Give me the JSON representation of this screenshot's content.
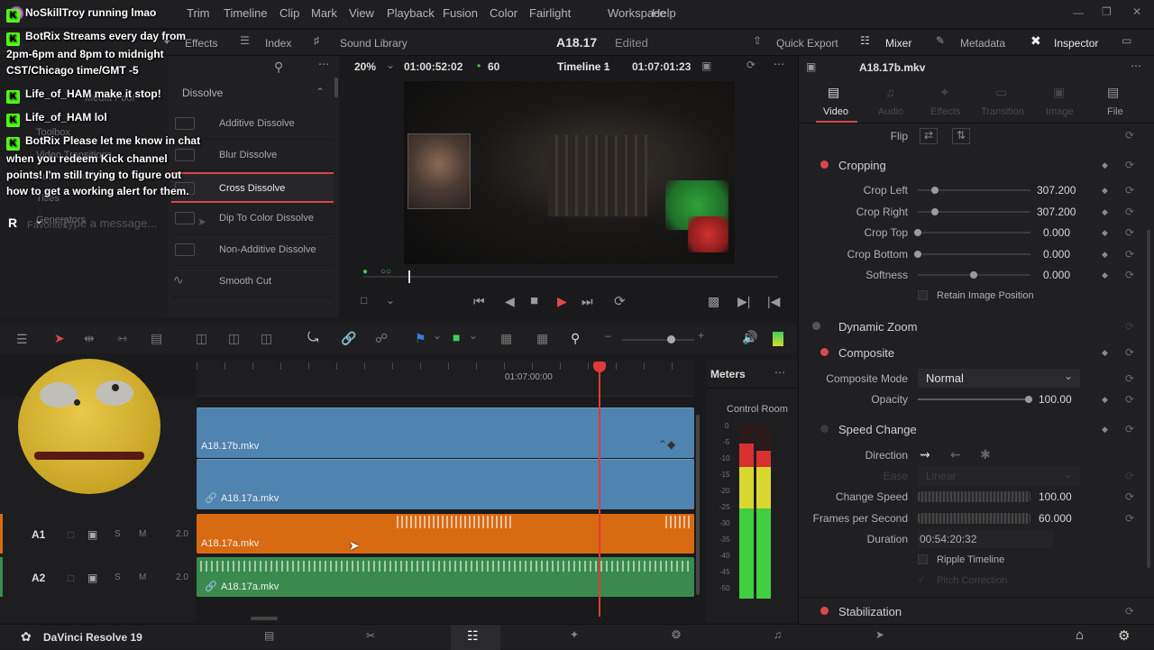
{
  "menubar": {
    "items": [
      "Trim",
      "Timeline",
      "Clip",
      "Mark",
      "View",
      "Playback",
      "Fusion",
      "Color",
      "Fairlight",
      "Workspace",
      "Help"
    ]
  },
  "toolbar": {
    "effects": "Effects",
    "index": "Index",
    "sound_library": "Sound Library",
    "project_name": "A18.17",
    "project_status": "Edited",
    "quick_export": "Quick Export",
    "mixer": "Mixer",
    "metadata": "Metadata",
    "inspector": "Inspector"
  },
  "chat": {
    "lines": [
      {
        "user": "NoSkillTroy",
        "text": "running lmao"
      },
      {
        "user": "BotRix",
        "text": "Streams every day from 2pm-6pm and 8pm to midnight CST/Chicago time/GMT -5"
      },
      {
        "user": "Life_of_HAM",
        "text": "make it stop!"
      },
      {
        "user": "Life_of_HAM",
        "text": "lol"
      },
      {
        "user": "BotRix",
        "text": "Please let me know in chat when you redeem Kick channel points! I'm still trying to figure out how to get a working alert for them."
      }
    ],
    "input_placeholder": "Type a message..."
  },
  "effects_panel": {
    "bg_labels": [
      "Media Pool",
      "Toolbox",
      "Video Transitions",
      "Audio Transitions",
      "Titles",
      "Generators",
      "Favorites"
    ],
    "header": "Dissolve",
    "items": [
      {
        "label": "Additive Dissolve",
        "selected": false
      },
      {
        "label": "Blur Dissolve",
        "selected": false
      },
      {
        "label": "Cross Dissolve",
        "selected": true
      },
      {
        "label": "Dip To Color Dissolve",
        "selected": false
      },
      {
        "label": "Non-Additive Dissolve",
        "selected": false
      },
      {
        "label": "Smooth Cut",
        "selected": false
      }
    ]
  },
  "viewer": {
    "zoom": "20%",
    "source_timecode": "01:00:52:02",
    "fps": "60",
    "timeline_name": "Timeline 1",
    "record_timecode": "01:07:01:23"
  },
  "inspector": {
    "clip_name": "A18.17b.mkv",
    "tabs": [
      {
        "label": "Video",
        "active": true
      },
      {
        "label": "Audio",
        "active": false
      },
      {
        "label": "Effects",
        "active": false
      },
      {
        "label": "Transition",
        "active": false
      },
      {
        "label": "Image",
        "active": false
      },
      {
        "label": "File",
        "active": false
      }
    ],
    "flip_label": "Flip",
    "cropping": {
      "title": "Cropping",
      "crop_left": {
        "label": "Crop Left",
        "value": "307.200"
      },
      "crop_right": {
        "label": "Crop Right",
        "value": "307.200"
      },
      "crop_top": {
        "label": "Crop Top",
        "value": "0.000"
      },
      "crop_bottom": {
        "label": "Crop Bottom",
        "value": "0.000"
      },
      "softness": {
        "label": "Softness",
        "value": "0.000"
      },
      "retain": "Retain Image Position"
    },
    "dynamic_zoom": "Dynamic Zoom",
    "composite": {
      "title": "Composite",
      "mode_label": "Composite Mode",
      "mode_value": "Normal",
      "opacity_label": "Opacity",
      "opacity_value": "100.00"
    },
    "speed_change": {
      "title": "Speed Change",
      "direction_label": "Direction",
      "ease_label": "Ease",
      "ease_value": "Linear",
      "change_speed_label": "Change Speed",
      "change_speed_value": "100.00",
      "fps_label": "Frames per Second",
      "fps_value": "60.000",
      "duration_label": "Duration",
      "duration_value": "00:54:20:32",
      "ripple_label": "Ripple Timeline",
      "pitch_label": "Pitch Correction"
    },
    "stabilization": "Stabilization"
  },
  "timeline": {
    "ruler_timecode": "01:07:00:00",
    "video_clips": [
      "A18.17b.mkv",
      "A18.17a.mkv"
    ],
    "audio_tracks": [
      {
        "name": "A1",
        "level": "2.0",
        "clip": "A18.17a.mkv"
      },
      {
        "name": "A2",
        "level": "2.0",
        "clip": "A18.17a.mkv"
      }
    ],
    "track_flag_s": "S",
    "track_flag_m": "M"
  },
  "meters": {
    "title": "Meters",
    "subtitle": "Control Room",
    "scale": [
      "0",
      "-5",
      "-10",
      "-15",
      "-20",
      "-25",
      "-30",
      "-35",
      "-40",
      "-45",
      "-50"
    ]
  },
  "bottombar": {
    "app_name": "DaVinci Resolve 19"
  },
  "colors": {
    "accent_red": "#e03a3a",
    "audio_orange": "#d86a12",
    "audio_green": "#3a8a4e",
    "video_blue": "#4f83b0"
  }
}
